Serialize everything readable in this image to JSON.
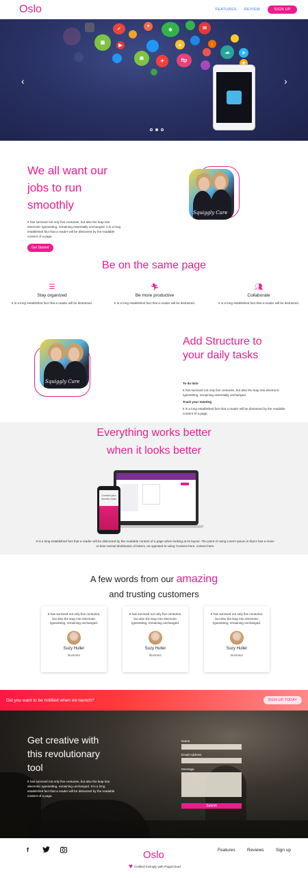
{
  "nav": {
    "logo": "Oslo",
    "links": [
      "FEATURES",
      "REVIEW"
    ],
    "signup": "SIGN UP"
  },
  "hero": {
    "icons": [
      "ICON",
      "TODO",
      "+",
      "DROPBOX",
      "GMAIL",
      "DRIVE",
      "FTP",
      "CLOUD",
      "FLIGHT",
      "ANDROID",
      "PDF",
      "GALLERY"
    ],
    "prev_icon": "chevron-left-icon",
    "next_icon": "chevron-right-icon",
    "slides": 3,
    "active_slide": 2
  },
  "jobs": {
    "title": "We all want our jobs to run smoothly",
    "body": "It has survived not only five centuries, but also the leap into electronic typesetting, remaining essentially unchanged. It is a long established fact that a reader will be distracted by the readable content of a page.",
    "cta": "Get Started",
    "photo_signature": "Squiggly Care"
  },
  "same_page": {
    "title": "Be on the same page",
    "features": [
      {
        "icon": "list-icon",
        "title": "Stay organized",
        "text": "It is a long established fact that a reader will be distracted."
      },
      {
        "icon": "runner-icon",
        "title": "Be more productive",
        "text": "It is a long established fact that a reader will be distracted."
      },
      {
        "icon": "people-icon",
        "title": "Collaborate",
        "text": "It is a long established fact that a reader will be distracted."
      }
    ]
  },
  "structure": {
    "title": "Add Structure to your daily tasks",
    "items": [
      {
        "heading": "To do lists",
        "text": "It has survived not only five centuries, but also the leap into electronic typesetting, remaining essentially unchanged."
      },
      {
        "heading": "Track your meeting",
        "text": "It is a long established fact that a reader will be distracted by the readable content of a page."
      }
    ],
    "photo_signature": "Squiggly Care"
  },
  "better": {
    "title_line1": "Everything works better",
    "title_line2": "when it looks better",
    "text": "It is a long established fact that a reader will be distracted by the readable content of a page when looking at its layout. The point of using Lorem Ipsum is that it has a more-or-less normal distribution of letters, as opposed to using 'Content here, content here.",
    "phone_screen_text": "Connect your favorite chats"
  },
  "testimonials": {
    "title_pre": "A few words from our",
    "title_accent": "amazing",
    "title_line2": "and trusting customers",
    "cards": [
      {
        "quote": "It has survived not only five centuries, but also the leap into electronic typesetting, remaining unchanged.",
        "name": "Suzy Huller",
        "role": "Illustrator"
      },
      {
        "quote": "It has survived not only five centuries, but also the leap into electronic typesetting, remaining unchanged.",
        "name": "Suzy Huller",
        "role": "Illustrator"
      },
      {
        "quote": "It has survived not only five centuries, but also the leap into electronic typesetting, remaining unchanged.",
        "name": "Suzy Huller",
        "role": "Illustrator"
      }
    ]
  },
  "notify": {
    "text": "Did you want to be notified when we launch?",
    "button": "SIGN UP TODAY"
  },
  "creative": {
    "title": "Get creative with this revolutionary tool",
    "text": "It has survived not only five centuries, but also the leap into electronic typesetting, remaining unchanged. It is a long established fact that a reader will be distracted by the readable content of a page.",
    "form": {
      "name_label": "Name",
      "email_label": "Email Address",
      "message_label": "Message",
      "submit": "Submit"
    }
  },
  "footer": {
    "social": [
      "facebook-icon",
      "twitter-icon",
      "instagram-icon"
    ],
    "logo": "Oslo",
    "links": [
      "Features",
      "Reviews",
      "Sign up"
    ],
    "credit": "Crafted lovingly with PageCloud"
  },
  "colors": {
    "accent": "#ec1c8e",
    "link": "#3a7bd5",
    "banner": "#ff1744"
  }
}
